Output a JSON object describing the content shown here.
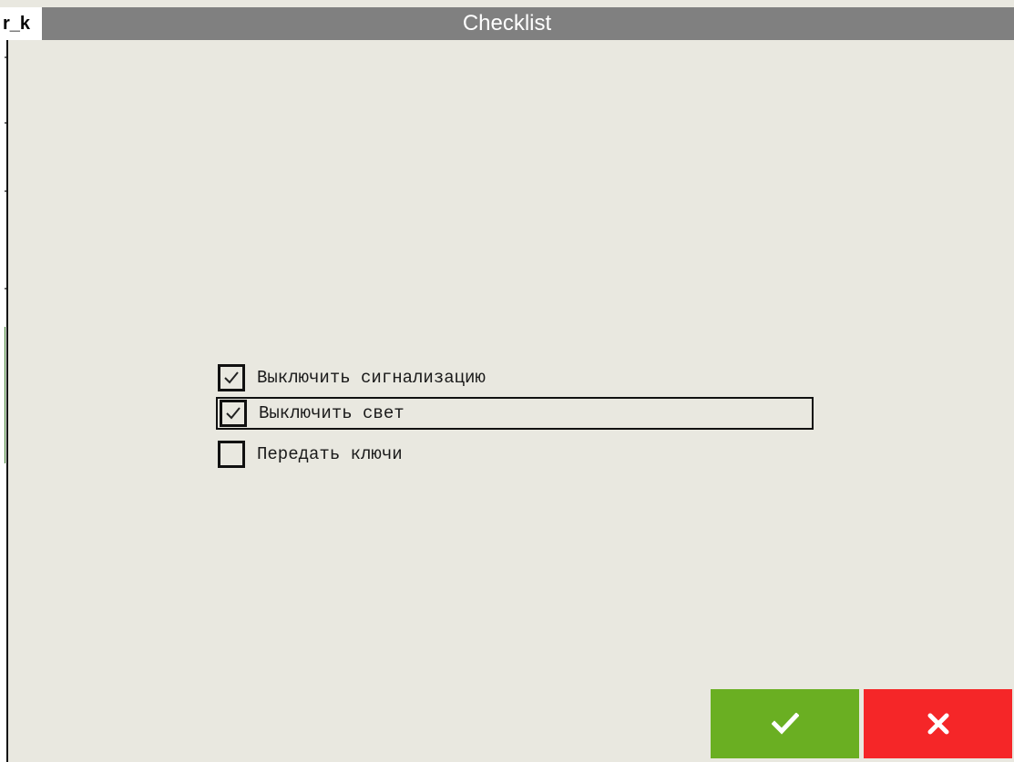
{
  "window": {
    "app_tag": "r_k",
    "title": "Checklist"
  },
  "checklist": {
    "items": [
      {
        "label": "Выключить сигнализацию",
        "checked": true,
        "focused": false
      },
      {
        "label": "Выключить свет",
        "checked": true,
        "focused": true
      },
      {
        "label": "Передать ключи",
        "checked": false,
        "focused": false
      }
    ]
  },
  "actions": {
    "confirm": {
      "icon": "check-icon",
      "color": "#6aaf22"
    },
    "cancel": {
      "icon": "close-icon",
      "color": "#f52628"
    }
  }
}
